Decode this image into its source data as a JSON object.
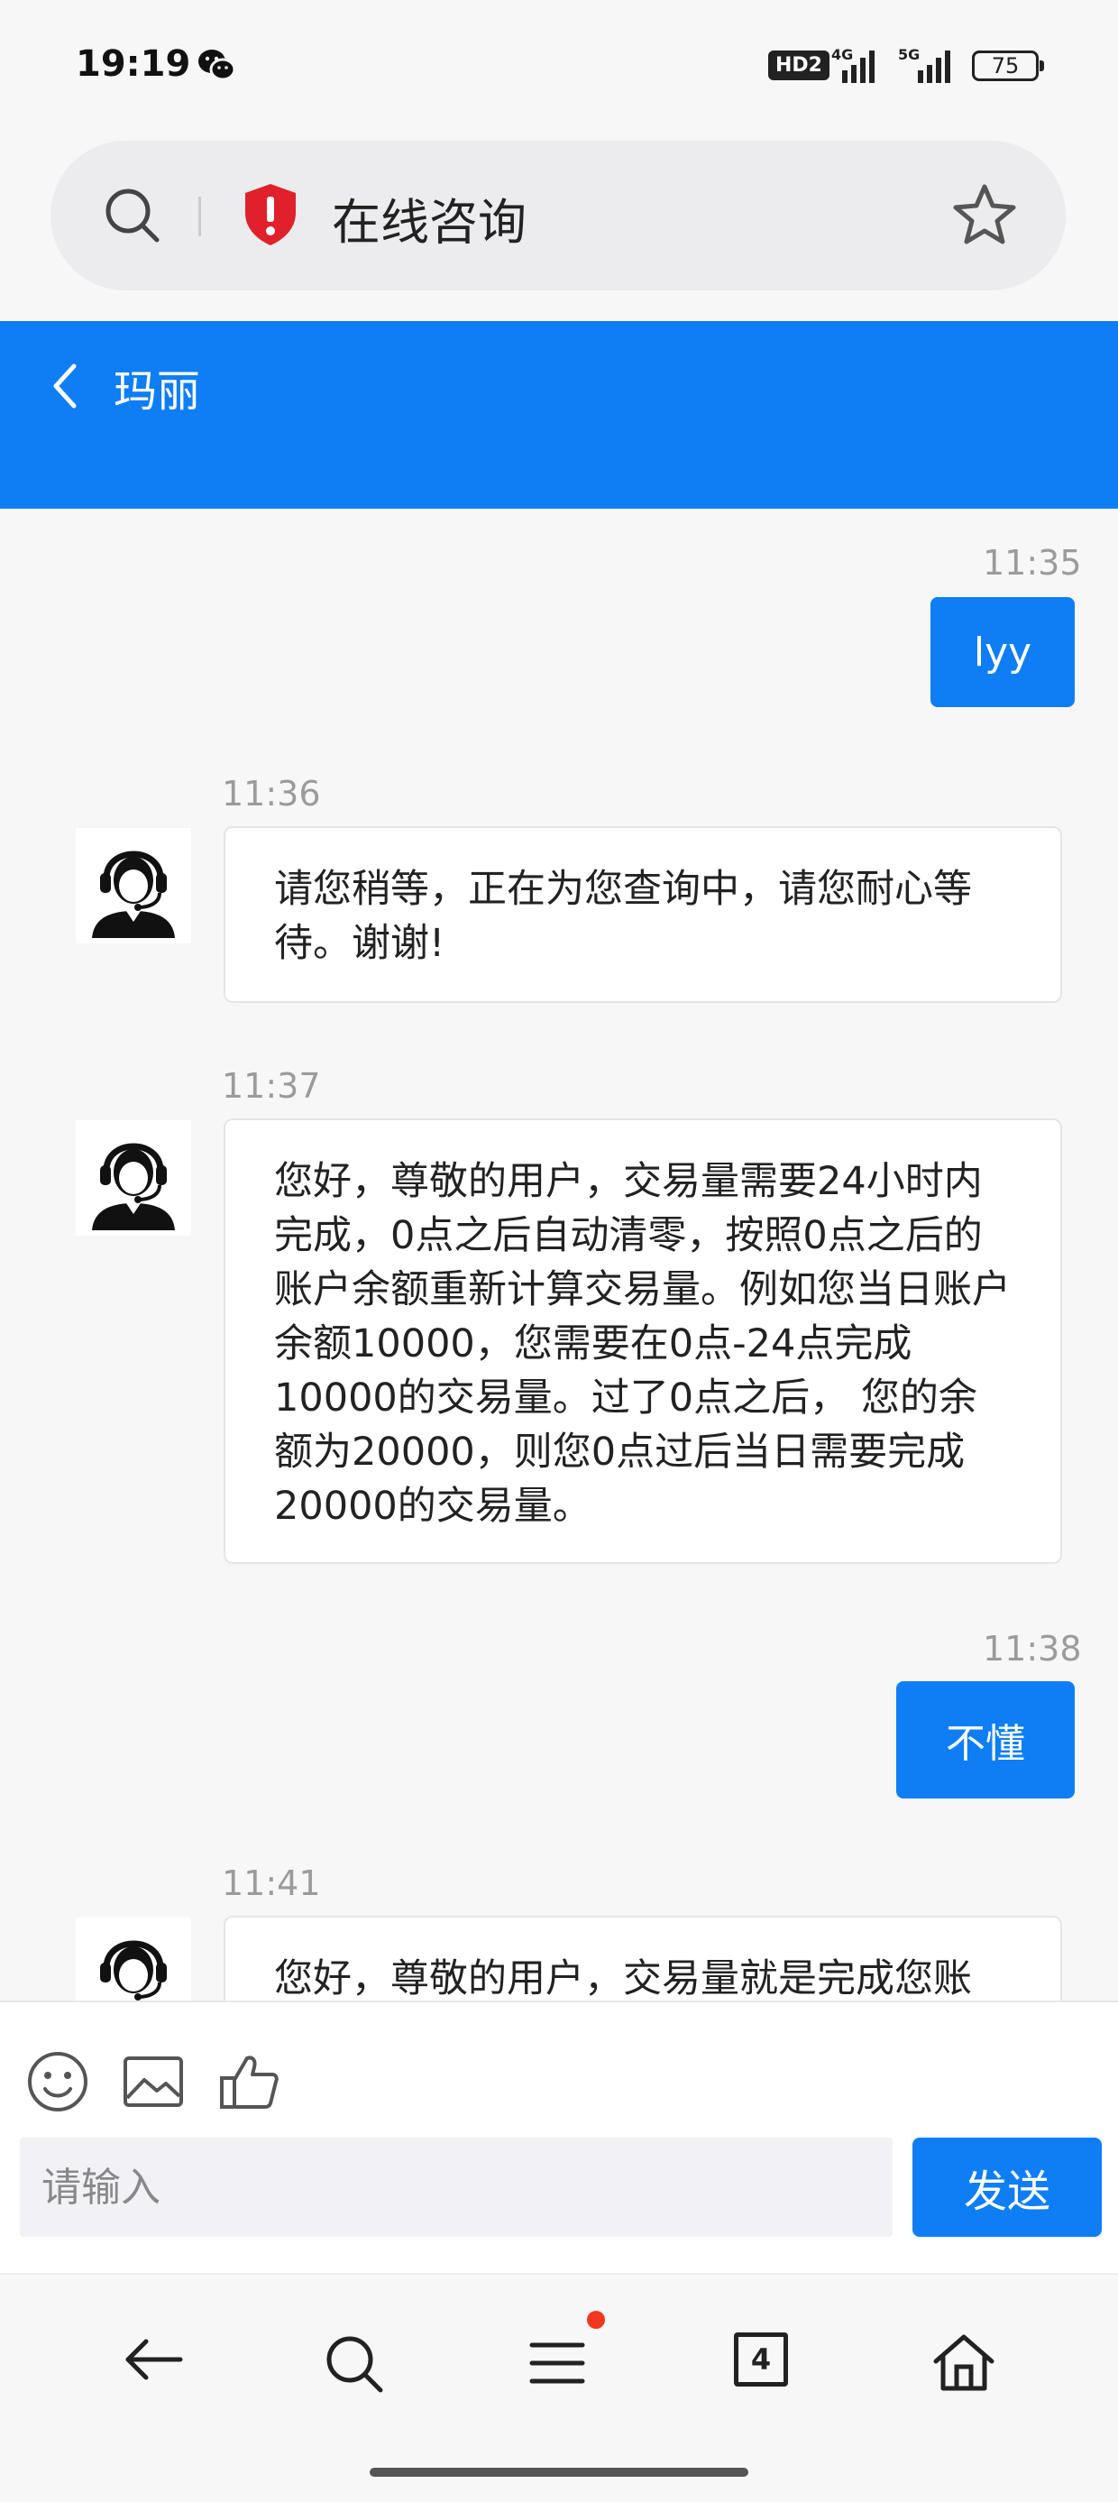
{
  "status_bar": {
    "time": "19:19",
    "hd": "HD2",
    "battery": "75"
  },
  "address_bar": {
    "title": "在线咨询"
  },
  "chat_header": {
    "agent_name": "玛丽"
  },
  "messages": [
    {
      "time": "11:35",
      "from": "user",
      "text": "lyy"
    },
    {
      "time": "11:36",
      "from": "agent",
      "text": "请您稍等，正在为您查询中，请您耐心等待。谢谢!"
    },
    {
      "time": "11:37",
      "from": "agent",
      "text": "您好，尊敬的用户，交易量需要24小时内完成，0点之后自动清零，按照0点之后的账户余额重新计算交易量。例如您当日账户余额10000，您需要在0点-24点完成10000的交易量。过了0点之后， 您的余额为20000，则您0点过后当日需要完成20000的交易量。"
    },
    {
      "time": "11:38",
      "from": "user",
      "text": "不懂"
    },
    {
      "time": "11:41",
      "from": "agent",
      "text": "您好，尊敬的用户，交易量就是完成您账"
    }
  ],
  "composer": {
    "placeholder": "请输入",
    "send_label": "发送"
  },
  "browser_nav": {
    "tabs_count": "4"
  },
  "colors": {
    "accent": "#0f7ef5",
    "shield": "#e0202a",
    "notification": "#f0381e"
  }
}
